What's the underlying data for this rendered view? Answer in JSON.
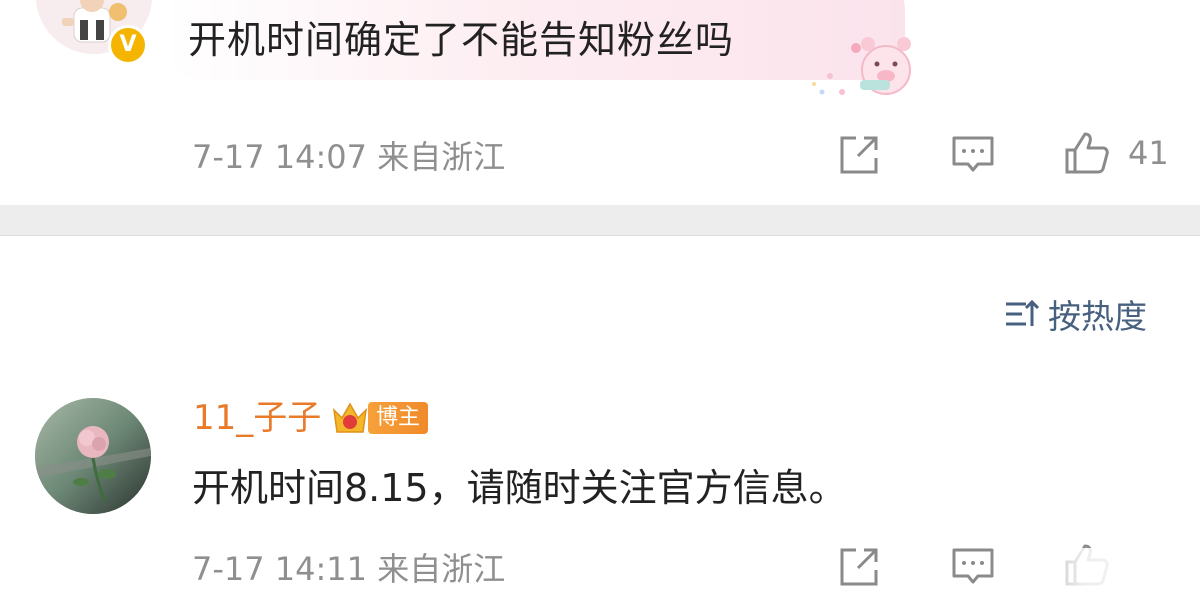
{
  "comment1": {
    "text": "开机时间确定了不能告知粉丝吗",
    "verified_badge": "V",
    "meta": "7-17 14:07  来自浙江",
    "likes": "41"
  },
  "sort": {
    "label": "按热度",
    "icon": "sort-icon"
  },
  "comment2": {
    "username": "11_子子",
    "badge": "博主",
    "text": "开机时间8.15，请随时关注官方信息。",
    "meta": "7-17 14:11  来自浙江"
  },
  "icons": {
    "share": "share-icon",
    "comment": "comment-icon",
    "like": "thumbs-up-icon",
    "crown": "crown-icon"
  },
  "colors": {
    "username": "#e87a2a",
    "sort_text": "#47607f",
    "meta": "#8f8f8f",
    "verified": "#f5b400",
    "badge": "#f08a2a"
  }
}
